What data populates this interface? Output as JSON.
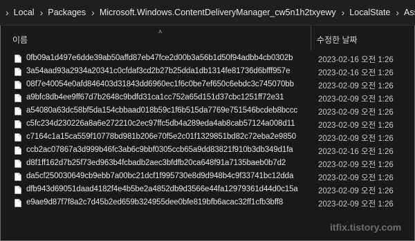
{
  "breadcrumb": [
    {
      "label": "Local"
    },
    {
      "label": "Packages"
    },
    {
      "label": "Microsoft.Windows.ContentDeliveryManager_cw5n1h2txyewy"
    },
    {
      "label": "LocalState"
    },
    {
      "label": "Assets"
    }
  ],
  "columns": {
    "name": "이름",
    "modified": "수정한 날짜"
  },
  "files": [
    {
      "name": "0fb09a1d497e6dde39ab50affd87eb47fce2d00b3a56b1d50f94adbb4cb0302b",
      "date": "2023-02-16 오전 1:26"
    },
    {
      "name": "3a54aad93a2934a20341c0cfdaf3cd2b27b25dda1db1314fe81736d6bfff957e",
      "date": "2023-02-16 오전 1:26"
    },
    {
      "name": "08f7e40054e0afd846403d31843dd6960ec1f6c0be7ef650c6ebdc3c745070bb",
      "date": "2023-02-09 오전 1:26"
    },
    {
      "name": "a9bfc8db4ee9ff67d7b2648c9bdfd31ca1cc752a65d151d37cbc1251ff72e31",
      "date": "2023-02-09 오전 1:26"
    },
    {
      "name": "a54080a63dc58bf5da154cbbaad018b59c1f6b515da7769e751546bcdeb8bccc",
      "date": "2023-02-09 오전 1:26"
    },
    {
      "name": "c5fc234d230226a8a6e272210c2ec97ffc5db4a289eda4ab8cab57124a008d11",
      "date": "2023-02-09 오전 1:26"
    },
    {
      "name": "c7164c1a15ca559f10778bd981b206e70f5e2c01f1329851bd82c72eba2e9850",
      "date": "2023-02-09 오전 1:26"
    },
    {
      "name": "ccb2ac07867a3d999b46fc3ab6c9bbf0305ccb65a9dd83821f910b3db349d1fa",
      "date": "2023-02-16 오전 1:26"
    },
    {
      "name": "d8f1ff162d7b25f73ed963b4fcbadb2aec3bfdfb20ca648f91a7135baeb0b7d2",
      "date": "2023-02-09 오전 1:26"
    },
    {
      "name": "da5cf250030649cb9ebb7a00bc21dcf1f995730e8d9d948b4c9f33741bc12dda",
      "date": "2023-02-09 오전 1:26"
    },
    {
      "name": "dfb943d69051daad4182f4e4b5be2a4852db9d3566e44fa12979361d44d0c15a",
      "date": "2023-02-09 오전 1:26"
    },
    {
      "name": "e9ae9d87f7f8a2c7d45b2ed659b324955dee0bfe819bfb6acac32ff1cfb3bff8",
      "date": "2023-02-09 오전 1:26"
    }
  ],
  "watermark": "itfix.tistory.com",
  "icons": {
    "breadcrumb_separator": "chevron-right-icon",
    "file": "file-icon",
    "sort": "sort-up-icon"
  }
}
